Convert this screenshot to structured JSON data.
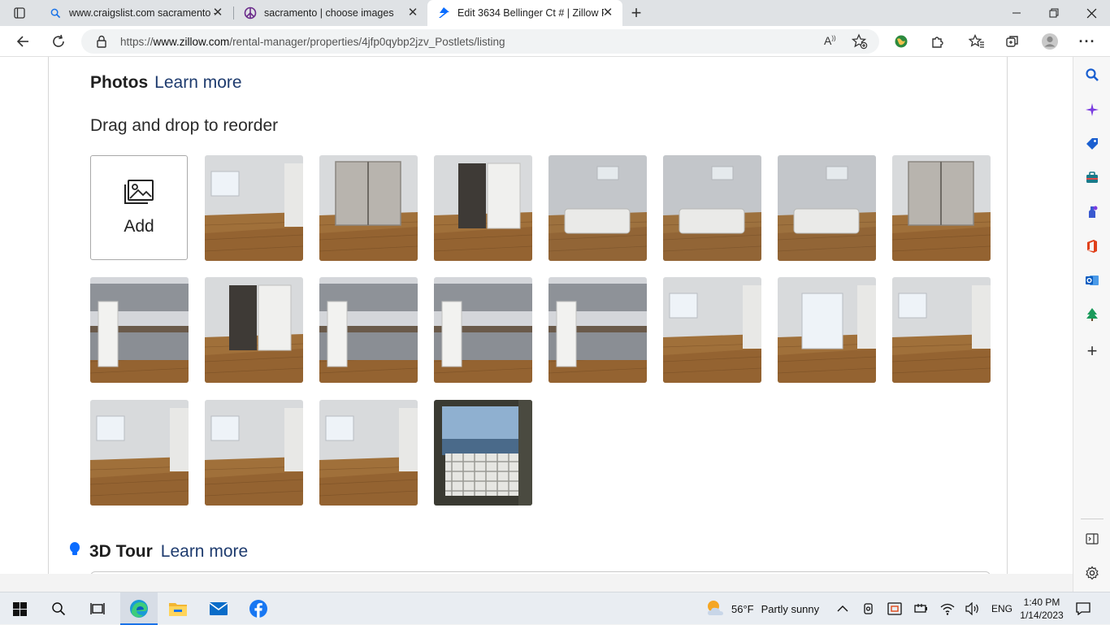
{
  "tabs": [
    {
      "title": "www.craigslist.com sacramento -",
      "icon": "search-icon"
    },
    {
      "title": "sacramento | choose images",
      "icon": "peace-icon"
    },
    {
      "title": "Edit 3634 Bellinger Ct # | Zillow R",
      "icon": "zillow-icon",
      "active": true
    }
  ],
  "address_bar": {
    "prefix": "https://",
    "domain": "www.zillow.com",
    "path": "/rental-manager/properties/4jfp0qybp2jzv_Postlets/listing"
  },
  "photos": {
    "title": "Photos",
    "learn_more": "Learn more",
    "instruction": "Drag and drop to reorder",
    "add_label": "Add",
    "count": 19
  },
  "tour": {
    "title": "3D Tour",
    "learn_more": "Learn more"
  },
  "taskbar": {
    "weather_temp": "56°F",
    "weather_desc": "Partly sunny",
    "language": "ENG",
    "time": "1:40 PM",
    "date": "1/14/2023"
  },
  "colors": {
    "link": "#1e3b6e",
    "edge_blue": "#0a6cff"
  }
}
